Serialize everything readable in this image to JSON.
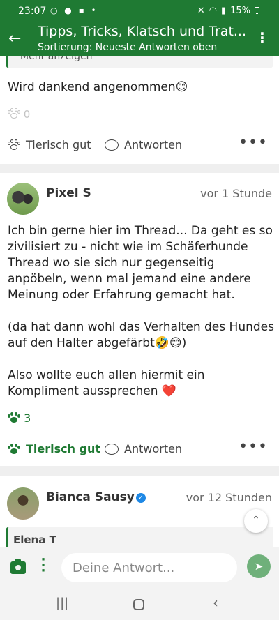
{
  "status_bar": {
    "time": "23:07",
    "battery": "15%",
    "left_icons": "○ ● ▪ •"
  },
  "app_bar": {
    "title": "Tipps, Tricks, Klatsch und Trat...",
    "subtitle": "Sortierung: Neueste Antworten oben"
  },
  "post1": {
    "quote_more": "Mehr anzeigen",
    "text": "Wird dankend angenommen😊",
    "likes": "0",
    "like_label": "Tierisch gut",
    "reply_label": "Antworten"
  },
  "post2": {
    "author": "Pixel S",
    "time": "vor 1 Stunde",
    "paragraphs": [
      "Ich bin gerne hier im Thread... Da geht es so zivilisiert zu - nicht wie im Schäferhunde Thread wo sie sich nur gegenseitig anpöbeln, wenn mal jemand eine andere Meinung oder Erfahrung gemacht hat.",
      "(da hat dann wohl das Verhalten des Hundes auf den Halter abgefärbt🤣😊)",
      "Also wollte euch allen hiermit ein Kompliment aussprechen ❤️"
    ],
    "likes": "3",
    "like_label": "Tierisch gut",
    "reply_label": "Antworten"
  },
  "post3": {
    "author": "Bianca Sausy",
    "time": "vor 12 Stunden",
    "quote_author": "Elena T"
  },
  "composer": {
    "placeholder": "Deine Antwort..."
  },
  "colors": {
    "brand": "#1f7a33",
    "send": "#6fb07a"
  }
}
